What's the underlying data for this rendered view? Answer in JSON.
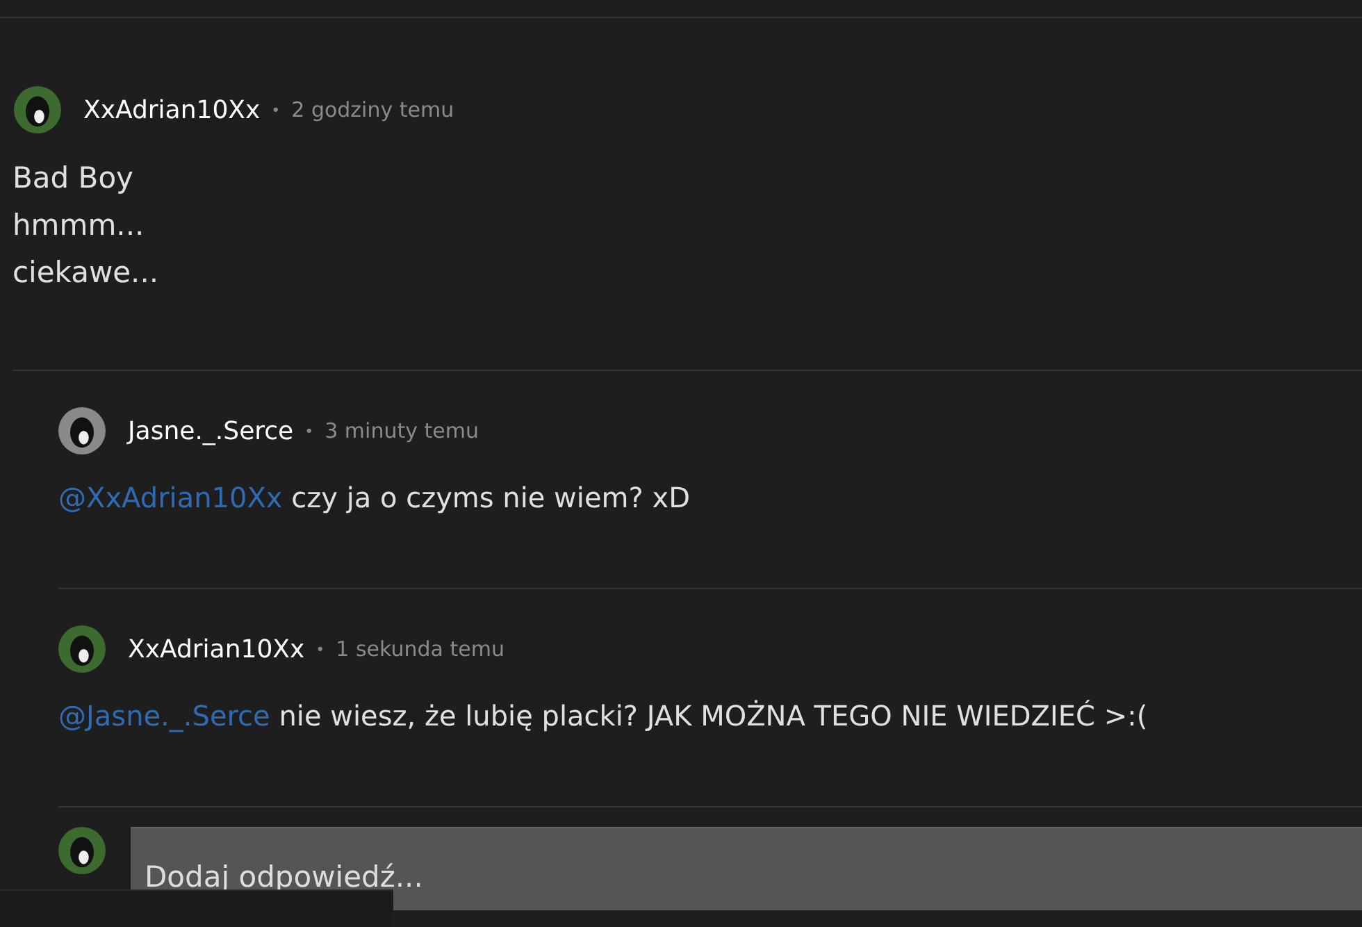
{
  "comment": {
    "author": "XxAdrian10Xx",
    "color": "#3d6b2f",
    "separator": "•",
    "time": "2 godziny temu",
    "lines": [
      "Bad Boy",
      "hmmm...",
      "ciekawe..."
    ]
  },
  "replies": [
    {
      "author": "Jasne._.Serce",
      "color": "#8a8a8a",
      "separator": "•",
      "time": "3 minuty temu",
      "mention": "@XxAdrian10Xx",
      "text": "czy ja o czyms nie wiem? xD"
    },
    {
      "author": "XxAdrian10Xx",
      "color": "#3d6b2f",
      "separator": "•",
      "time": "1 sekunda temu",
      "mention": "@Jasne._.Serce",
      "text": "nie wiesz, że lubię placki? JAK MOŻNA TEGO NIE WIEDZIEĆ >:("
    }
  ],
  "reply_form": {
    "color": "#3d6b2f",
    "placeholder": "Dodaj odpowiedź..."
  }
}
